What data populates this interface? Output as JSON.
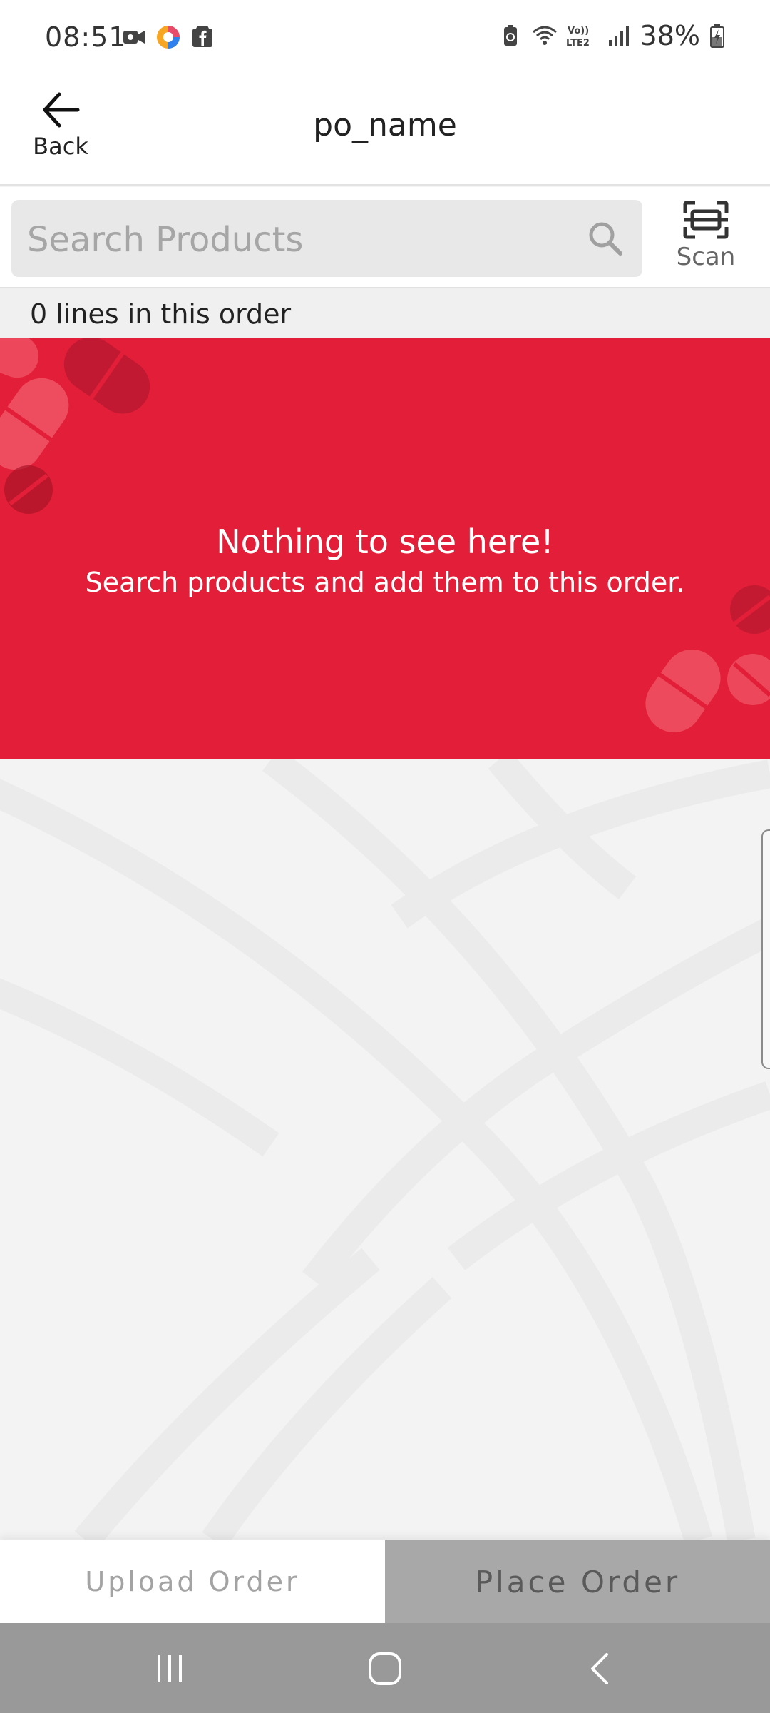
{
  "status_bar": {
    "time": "08:51",
    "battery_percent": "38%",
    "left_icons": [
      "video-call-icon",
      "colorful-app-icon",
      "facebook-store-icon"
    ],
    "right_icons": [
      "battery-saver-icon",
      "wifi-icon",
      "volte-lte2-icon",
      "signal-icon",
      "battery-charging-icon"
    ]
  },
  "header": {
    "back_label": "Back",
    "title": "po_name"
  },
  "search": {
    "placeholder": "Search Products",
    "scan_label": "Scan"
  },
  "order": {
    "lines_text": "0 lines in this order"
  },
  "empty_state": {
    "title": "Nothing to see here!",
    "subtitle": "Search products and add them to this order.",
    "background_color": "#e31e38"
  },
  "actions": {
    "upload_label": "Upload Order",
    "place_label": "Place Order"
  },
  "system_nav": {
    "buttons": [
      "recent-apps-icon",
      "home-icon",
      "back-nav-icon"
    ]
  }
}
